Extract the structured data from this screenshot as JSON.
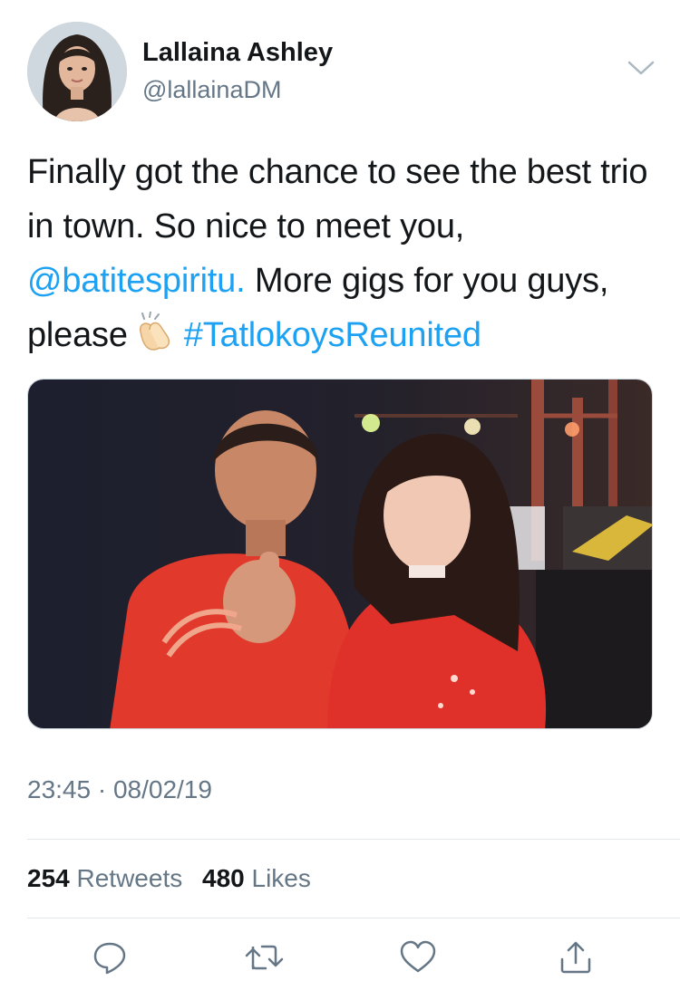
{
  "author": {
    "name": "Lallaina Ashley",
    "handle": "@lallainaDM"
  },
  "tweet": {
    "text_1": "Finally got the chance to see the best trio in town. So nice to meet you, ",
    "mention": "@batitespiritu.",
    "text_2": " More gigs for you guys, please",
    "emoji": "clapping-hands",
    "hashtag": "#TatlokoysReunited",
    "timestamp": "23:45 · 08/02/19"
  },
  "stats": {
    "retweets_count": "254",
    "retweets_label": "Retweets",
    "likes_count": "480",
    "likes_label": "Likes"
  },
  "actions": [
    "reply-icon",
    "retweet-icon",
    "like-icon",
    "share-icon"
  ],
  "colors": {
    "link": "#1da1f2",
    "secondary_text": "#657786",
    "primary_text": "#14171a",
    "divider": "#e1e8ed"
  }
}
